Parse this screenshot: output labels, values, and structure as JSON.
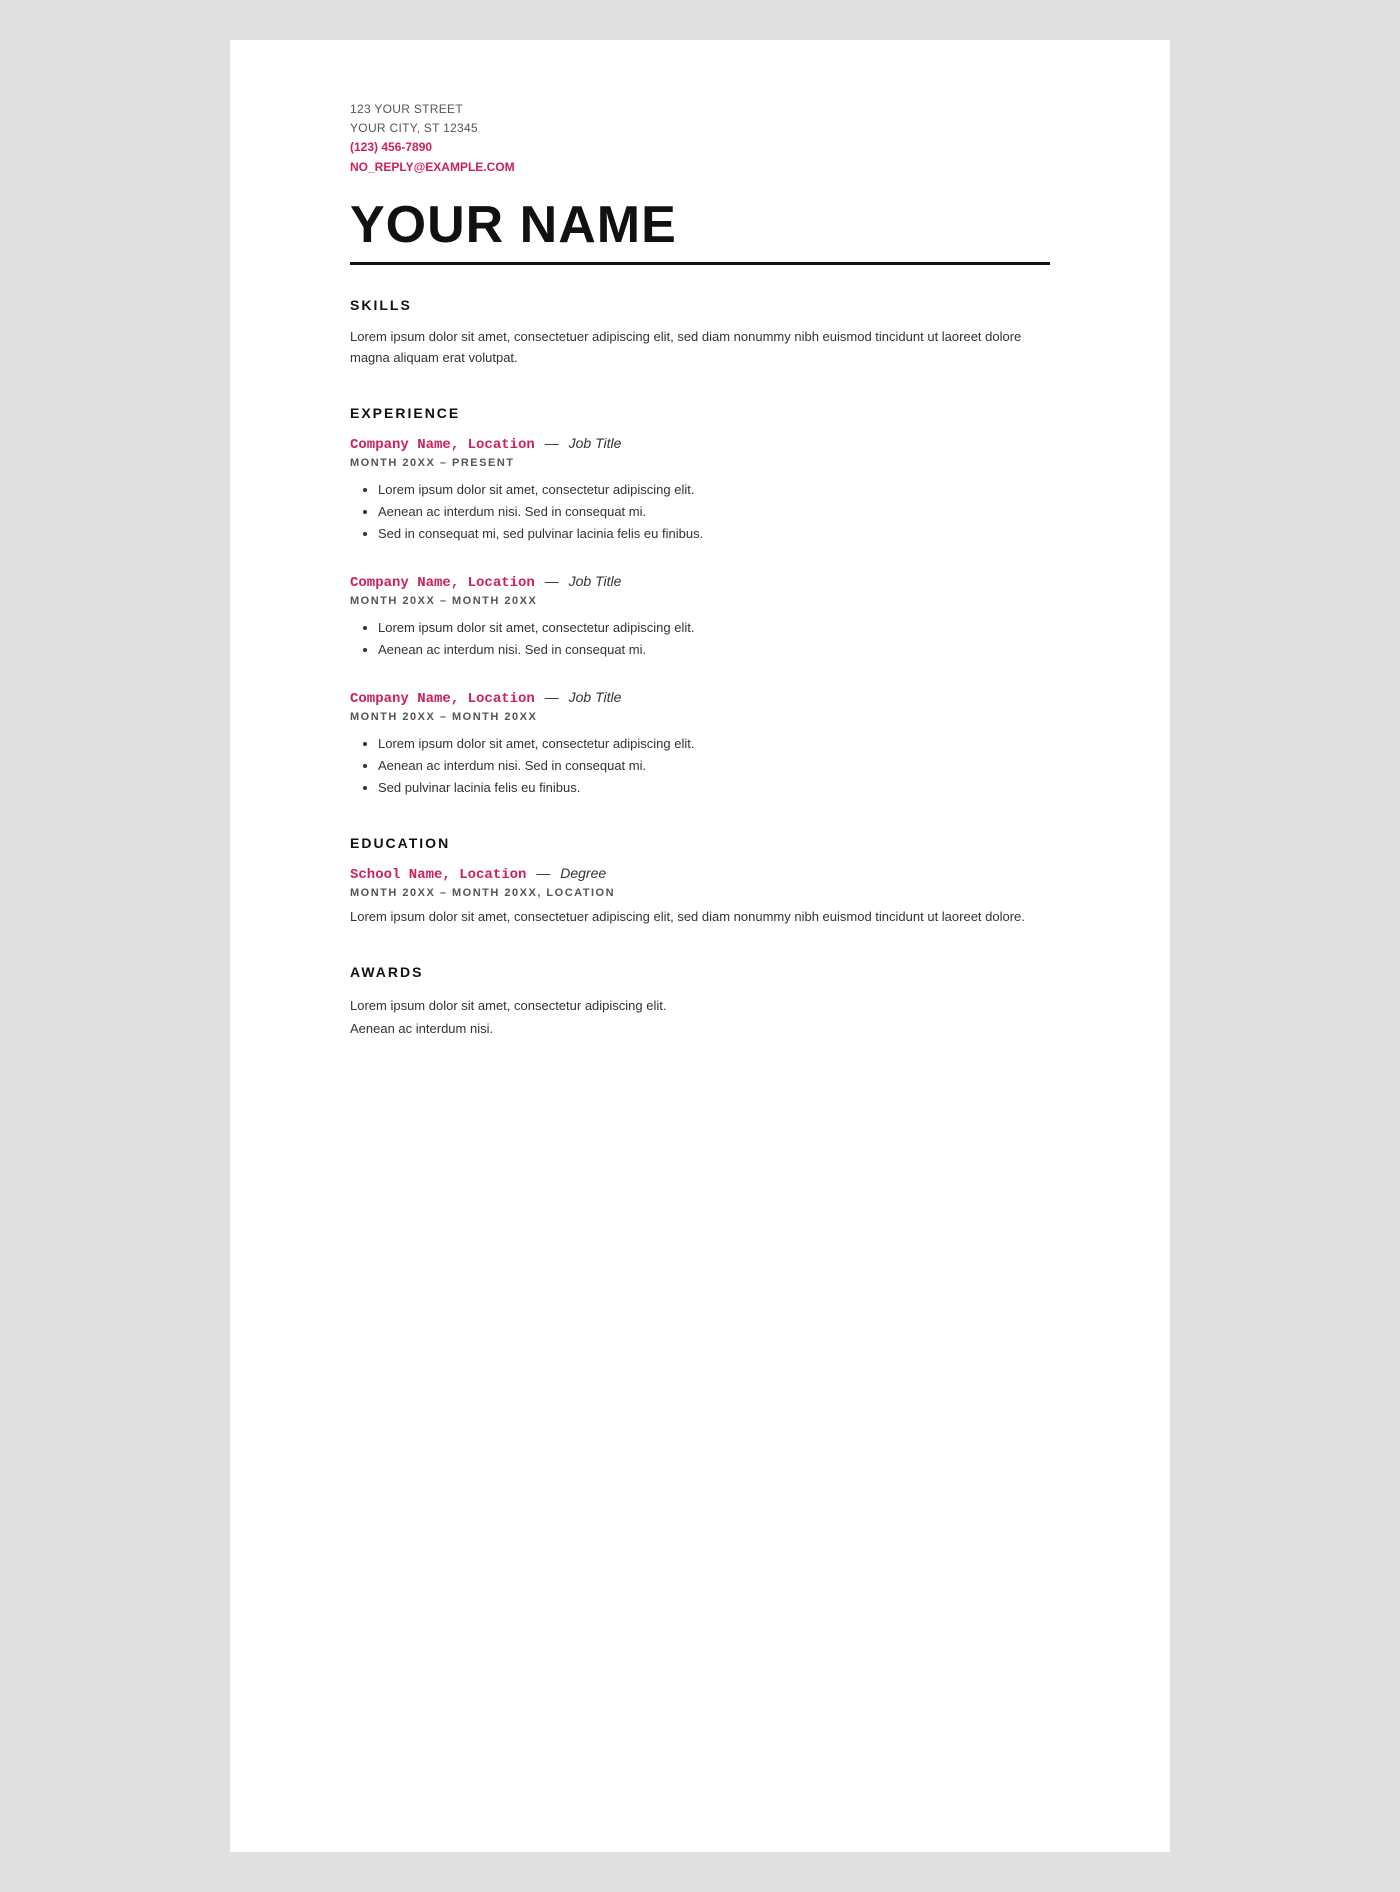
{
  "contact": {
    "street": "123 YOUR STREET",
    "city": "YOUR CITY, ST 12345",
    "phone": "(123) 456-7890",
    "email": "NO_REPLY@EXAMPLE.COM"
  },
  "name": "YOUR NAME",
  "divider": "",
  "sections": {
    "skills": {
      "title": "SKILLS",
      "body": "Lorem ipsum dolor sit amet, consectetuer adipiscing elit, sed diam nonummy nibh euismod tincidunt ut laoreet dolore magna aliquam erat volutpat."
    },
    "experience": {
      "title": "EXPERIENCE",
      "jobs": [
        {
          "company": "Company Name, Location",
          "separator": "—",
          "title": "Job Title",
          "dates": "MONTH 20XX – PRESENT",
          "bullets": [
            "Lorem ipsum dolor sit amet, consectetur adipiscing elit.",
            "Aenean ac interdum nisi. Sed in consequat mi.",
            "Sed in consequat mi, sed pulvinar lacinia felis eu finibus."
          ]
        },
        {
          "company": "Company Name, Location",
          "separator": "—",
          "title": "Job Title",
          "dates": "MONTH 20XX – MONTH 20XX",
          "bullets": [
            "Lorem ipsum dolor sit amet, consectetur adipiscing elit.",
            "Aenean ac interdum nisi. Sed in consequat mi."
          ]
        },
        {
          "company": "Company Name, Location",
          "separator": "—",
          "title": "Job Title",
          "dates": "MONTH 20XX – MONTH 20XX",
          "bullets": [
            "Lorem ipsum dolor sit amet, consectetur adipiscing elit.",
            "Aenean ac interdum nisi. Sed in consequat mi.",
            "Sed pulvinar lacinia felis eu finibus."
          ]
        }
      ]
    },
    "education": {
      "title": "EDUCATION",
      "entries": [
        {
          "school": "School Name, Location",
          "separator": "—",
          "degree": "Degree",
          "dates": "MONTH 20XX – MONTH 20XX, LOCATION",
          "body": "Lorem ipsum dolor sit amet, consectetuer adipiscing elit, sed diam nonummy nibh euismod tincidunt ut laoreet dolore."
        }
      ]
    },
    "awards": {
      "title": "AWARDS",
      "lines": [
        "Lorem ipsum dolor sit amet, consectetur adipiscing elit.",
        "Aenean ac interdum nisi."
      ]
    }
  }
}
